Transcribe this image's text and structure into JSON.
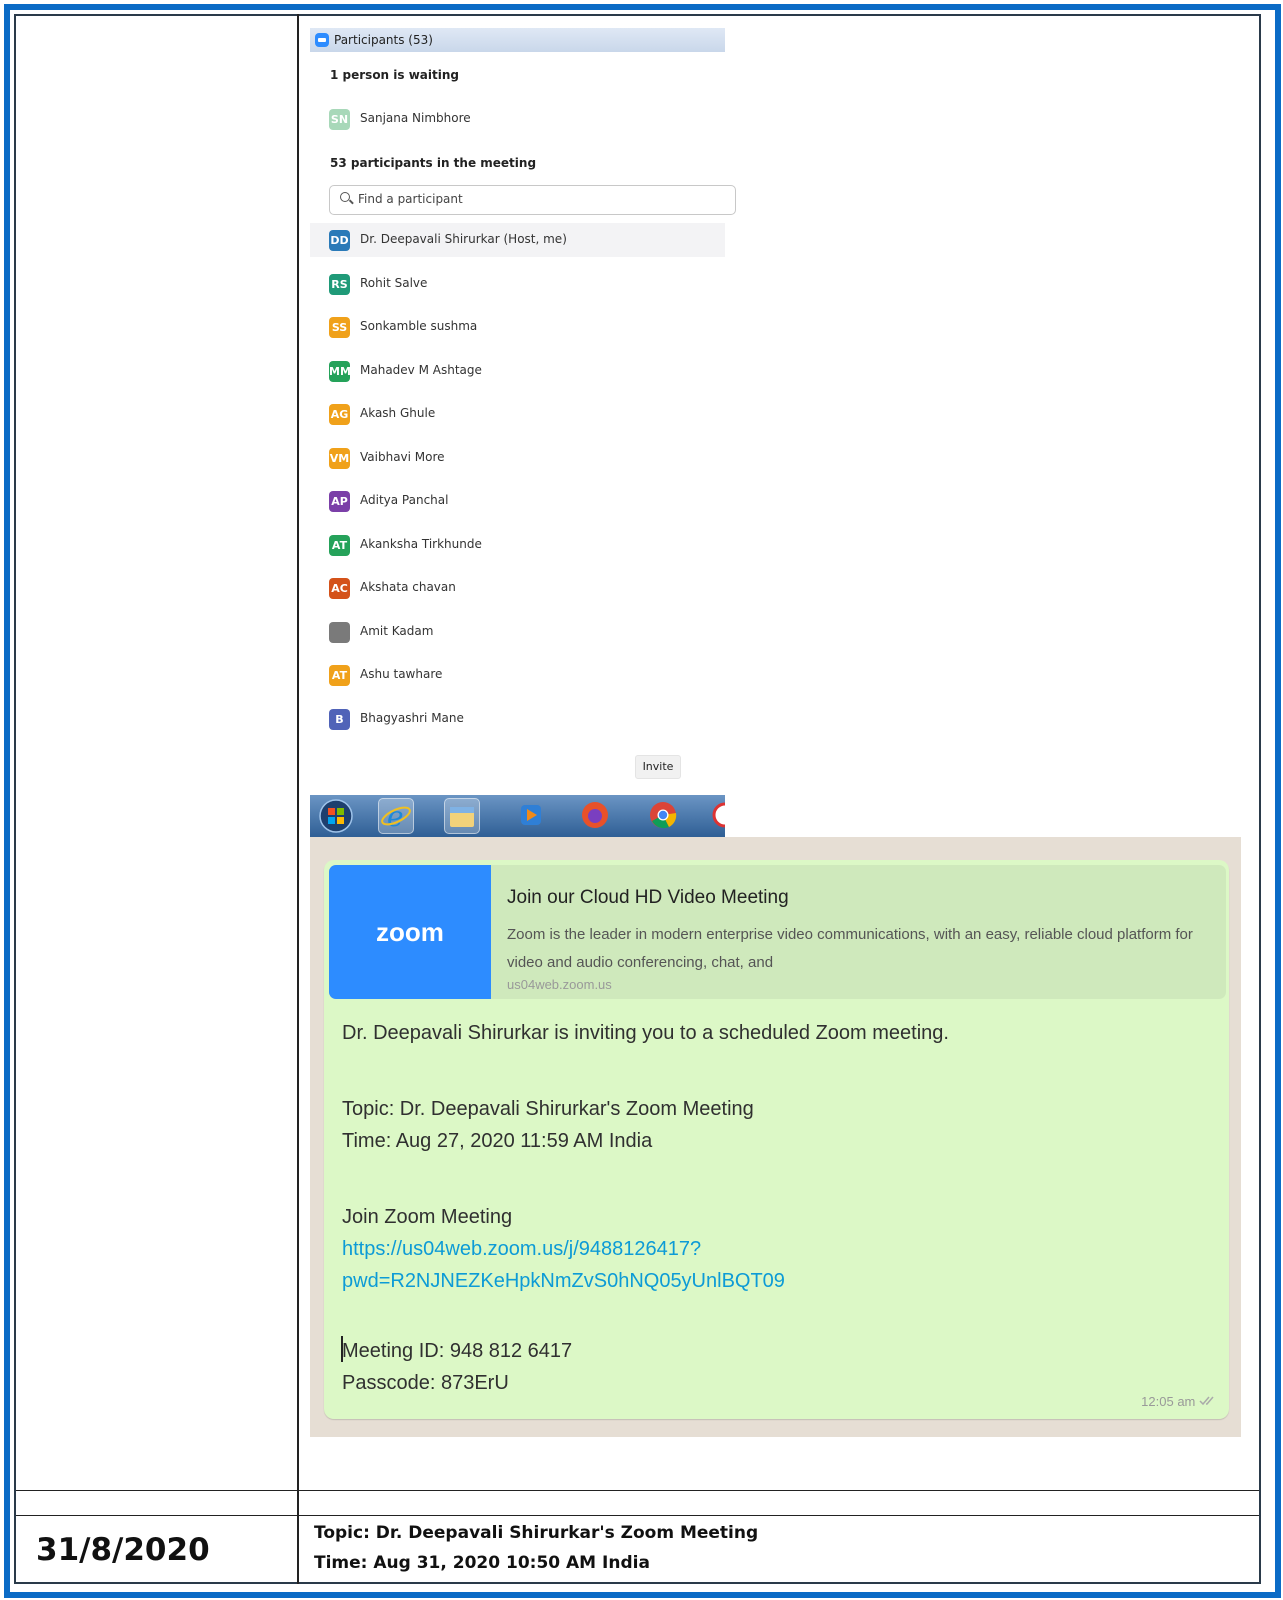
{
  "panel": {
    "title": "Participants (53)",
    "waiting_header": "1 person is waiting",
    "waiting": [
      {
        "initials": "SN",
        "name": "Sanjana Nimbhore",
        "color": "#a8d8b9"
      }
    ],
    "meeting_header": "53 participants in the meeting",
    "search_placeholder": "Find a participant",
    "participants": [
      {
        "initials": "DD",
        "name": "Dr. Deepavali Shirurkar (Host, me)",
        "color": "#2a7ab8"
      },
      {
        "initials": "RS",
        "name": "Rohit Salve",
        "color": "#1f9a78"
      },
      {
        "initials": "SS",
        "name": "Sonkamble sushma",
        "color": "#f0a11a"
      },
      {
        "initials": "MM",
        "name": "Mahadev M Ashtage",
        "color": "#25a25a"
      },
      {
        "initials": "AG",
        "name": "Akash Ghule",
        "color": "#f0a11a"
      },
      {
        "initials": "VM",
        "name": "Vaibhavi More",
        "color": "#f0a11a"
      },
      {
        "initials": "AP",
        "name": "Aditya Panchal",
        "color": "#7b3fa8"
      },
      {
        "initials": "AT",
        "name": "Akanksha Tirkhunde",
        "color": "#25a25a"
      },
      {
        "initials": "AC",
        "name": "Akshata chavan",
        "color": "#d4521a"
      },
      {
        "initials": "",
        "name": "Amit Kadam",
        "color": "#7a7a7a"
      },
      {
        "initials": "AT",
        "name": "Ashu tawhare",
        "color": "#f0a11a"
      },
      {
        "initials": "B",
        "name": "Bhagyashri Mane",
        "color": "#5063b8"
      }
    ],
    "invite_label": "Invite"
  },
  "taskbar": {
    "items": [
      "windows-start-icon",
      "internet-explorer-icon",
      "file-explorer-icon",
      "media-player-icon",
      "firefox-icon",
      "chrome-icon",
      "snipping-tool-icon"
    ]
  },
  "whatsapp": {
    "card_logo": "zoom",
    "card_title": "Join our Cloud HD Video Meeting",
    "card_desc": "Zoom is the leader in modern enterprise video communications, with an easy, reliable cloud platform for video and audio conferencing, chat, and",
    "card_url": "us04web.zoom.us",
    "invite_line": "Dr. Deepavali Shirurkar is inviting you to a scheduled Zoom meeting.",
    "topic": "Topic: Dr. Deepavali Shirurkar's Zoom Meeting",
    "time": "Time: Aug 27, 2020 11:59 AM India",
    "join_header": "Join Zoom Meeting",
    "join_link_1": "https://us04web.zoom.us/j/9488126417?",
    "join_link_2": "pwd=R2NJNEZKeHpkNmZvS0hNQ05yUnlBQT09",
    "meeting_id": "Meeting ID: 948 812 6417",
    "passcode": "Passcode: 873ErU",
    "timestamp": "12:05 am"
  },
  "table": {
    "date": "31/8/2020",
    "topic": "Topic: Dr. Deepavali Shirurkar's Zoom Meeting",
    "time": "Time: Aug 31, 2020 10:50 AM India"
  }
}
